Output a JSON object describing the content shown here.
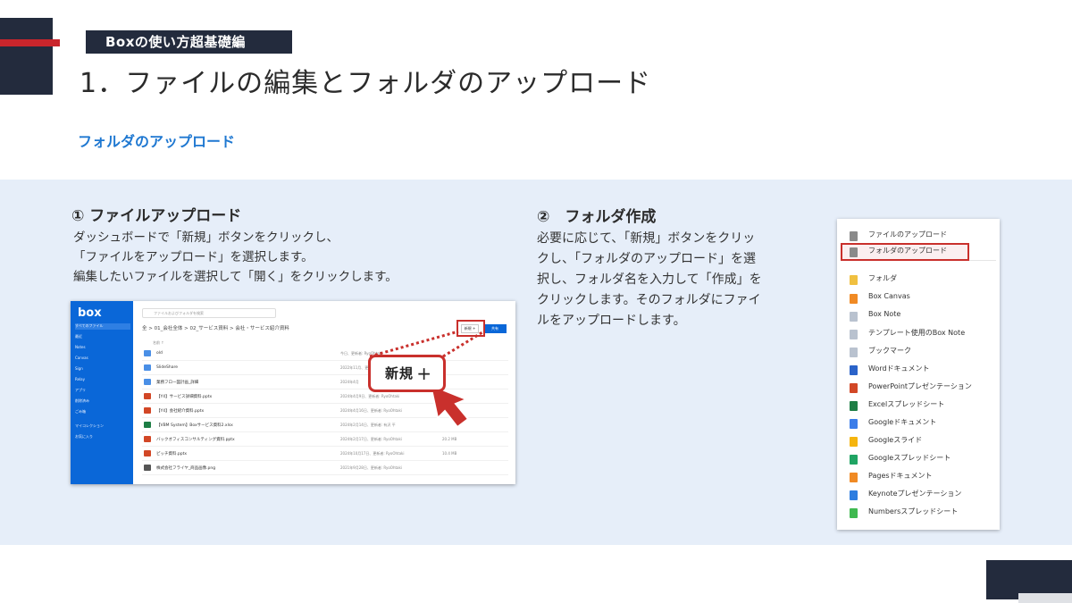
{
  "tag": "Boxの使い方超基礎編",
  "title": "1．ファイルの編集とフォルダのアップロード",
  "subtitle": "フォルダのアップロード",
  "step1": {
    "heading": "① ファイルアップロード",
    "lines": [
      "ダッシュボードで「新規」ボタンをクリックし、",
      "「ファイルをアップロード」を選択します。",
      "編集したいファイルを選択して「開く」をクリックします。"
    ]
  },
  "step2": {
    "heading": "②　フォルダ作成",
    "lines": [
      "必要に応じて、「新規」ボタンをクリッ",
      "クし、「フォルダのアップロード」を選",
      "択し、フォルダ名を入力して「作成」を",
      "クリックします。そのフォルダにファイ",
      "ルをアップロードします。"
    ]
  },
  "screenshot": {
    "logo": "box",
    "search_placeholder": "ファイルおよびフォルダを検索",
    "nav": [
      "すべてのファイル",
      "最近",
      "Notes",
      "Canvas",
      "Sign",
      "Relay",
      "アプリ",
      "削除済み",
      "ごみ箱",
      "マイコレクション",
      "お気に入り"
    ],
    "breadcrumb": "全 > 01_会社全体 > 02_サービス資料 > 会社・サービス紹介資料",
    "new_button": "新規 +",
    "upload_button": "共有",
    "column_name": "名前 ↑",
    "rows": [
      {
        "name": "old",
        "date": "今日、更新者: RyoOhtaki",
        "size": "",
        "color": "#4a8fe6"
      },
      {
        "name": "SlideShare",
        "date": "2022年11月、更新者: RyoOhtaki",
        "size": "",
        "color": "#4a8fe6"
      },
      {
        "name": "業務フロー図計画_詳細",
        "date": "2024年4月",
        "size": "",
        "color": "#4a8fe6"
      },
      {
        "name": "【Y4】サービス詳細資料.pptx",
        "date": "2024年4月9日、更新者: RyoOhtaki",
        "size": "",
        "color": "#d24726"
      },
      {
        "name": "【Y4】会社紹介資料.pptx",
        "date": "2024年4月16日、更新者: RyoOhtaki",
        "size": "",
        "color": "#d24726"
      },
      {
        "name": "【VBM System】Boxサービス資料2.xlsx",
        "date": "2024年2月14日、更新者: 有沢 平",
        "size": "",
        "color": "#1e7e45"
      },
      {
        "name": "バックオフィスコンサルティング資料.pptx",
        "date": "2024年2月17日、更新者: RyoOhtaki",
        "size": "20.2 MB",
        "color": "#d24726"
      },
      {
        "name": "ピッチ資料.pptx",
        "date": "2024年10月17日、更新者: RyoOhtaki",
        "size": "10.4 MB",
        "color": "#d24726"
      },
      {
        "name": "株式会社フライヤ_商品画像.png",
        "date": "2021年9月28日、更新者: RyoOhtaki",
        "size": "",
        "color": "#555555"
      }
    ],
    "callout_label": "新規",
    "callout_plus": "+"
  },
  "menu": {
    "items": [
      {
        "label": "ファイルのアップロード",
        "icon": "upload-icon",
        "color": "#8a8a8a"
      },
      {
        "label": "フォルダのアップロード",
        "icon": "folder-upload-icon",
        "color": "#8a8a8a",
        "highlighted": true
      },
      {
        "label": "フォルダ",
        "icon": "folder-icon",
        "color": "#f0c040"
      },
      {
        "label": "Box Canvas",
        "icon": "canvas-icon",
        "color": "#f08a24"
      },
      {
        "label": "Box Note",
        "icon": "note-icon",
        "color": "#b9c2cf"
      },
      {
        "label": "テンプレート使用のBox Note",
        "icon": "template-note-icon",
        "color": "#b9c2cf"
      },
      {
        "label": "ブックマーク",
        "icon": "bookmark-icon",
        "color": "#b9c2cf"
      },
      {
        "label": "Wordドキュメント",
        "icon": "word-icon",
        "color": "#2b63c9"
      },
      {
        "label": "PowerPointプレゼンテーション",
        "icon": "powerpoint-icon",
        "color": "#d24726"
      },
      {
        "label": "Excelスプレッドシート",
        "icon": "excel-icon",
        "color": "#1e7e45"
      },
      {
        "label": "Googleドキュメント",
        "icon": "google-docs-icon",
        "color": "#3b7de9"
      },
      {
        "label": "Googleスライド",
        "icon": "google-slides-icon",
        "color": "#f5b50e"
      },
      {
        "label": "Googleスプレッドシート",
        "icon": "google-sheets-icon",
        "color": "#1fa463"
      },
      {
        "label": "Pagesドキュメント",
        "icon": "pages-icon",
        "color": "#f08a24"
      },
      {
        "label": "Keynoteプレゼンテーション",
        "icon": "keynote-icon",
        "color": "#2d7de0"
      },
      {
        "label": "Numbersスプレッドシート",
        "icon": "numbers-icon",
        "color": "#3fb950"
      }
    ]
  },
  "colors": {
    "navy": "#232b3d",
    "red": "#c9252c",
    "blue": "#1f78d1",
    "panel": "#e6eef9"
  }
}
